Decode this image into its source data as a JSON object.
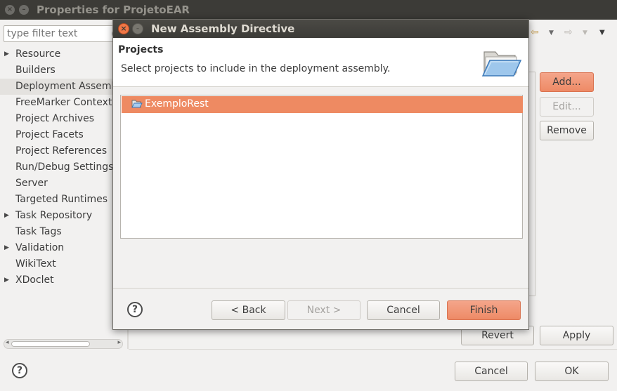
{
  "outer_window": {
    "title": "Properties for ProjetoEAR",
    "filter_placeholder": "type filter text",
    "tree_items": [
      {
        "label": "Resource",
        "expandable": true
      },
      {
        "label": "Builders",
        "expandable": false
      },
      {
        "label": "Deployment Assembly",
        "expandable": false,
        "selected": true
      },
      {
        "label": "FreeMarker Context",
        "expandable": false
      },
      {
        "label": "Project Archives",
        "expandable": false
      },
      {
        "label": "Project Facets",
        "expandable": false
      },
      {
        "label": "Project References",
        "expandable": false
      },
      {
        "label": "Run/Debug Settings",
        "expandable": false
      },
      {
        "label": "Server",
        "expandable": false
      },
      {
        "label": "Targeted Runtimes",
        "expandable": false
      },
      {
        "label": "Task Repository",
        "expandable": true
      },
      {
        "label": "Task Tags",
        "expandable": false
      },
      {
        "label": "Validation",
        "expandable": true
      },
      {
        "label": "WikiText",
        "expandable": false
      },
      {
        "label": "XDoclet",
        "expandable": true
      }
    ],
    "side_buttons": {
      "add": "Add...",
      "edit": "Edit...",
      "remove": "Remove"
    },
    "revert_label": "Revert",
    "apply_label": "Apply",
    "cancel_label": "Cancel",
    "ok_label": "OK"
  },
  "dialog": {
    "title": "New Assembly Directive",
    "header_title": "Projects",
    "header_description": "Select projects to include in the deployment assembly.",
    "projects": [
      "ExemploRest"
    ],
    "buttons": {
      "back": "< Back",
      "next": "Next >",
      "cancel": "Cancel",
      "finish": "Finish"
    }
  },
  "colors": {
    "accent": "#ee8a62",
    "titlebar": "#3c3b37",
    "window_bg": "#f2f1f0"
  }
}
